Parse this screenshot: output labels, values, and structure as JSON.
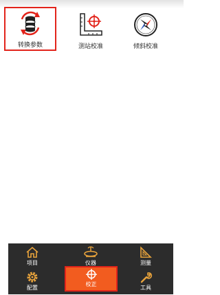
{
  "tools": [
    {
      "label": "转换参数",
      "icon": "database-refresh-icon"
    },
    {
      "label": "测站校准",
      "icon": "ruler-crosshair-icon"
    },
    {
      "label": "倾斜校准",
      "icon": "compass-icon"
    }
  ],
  "bottom_nav": {
    "project": "项目",
    "instrument": "仪器",
    "survey": "测量",
    "config": "配置",
    "calibrate": "校正",
    "tools": "工具"
  },
  "colors": {
    "accent": "#f25c1f",
    "highlight_border": "#e2231a",
    "nav_background": "#2c2c2c",
    "icon_orange": "#e8a33c"
  }
}
